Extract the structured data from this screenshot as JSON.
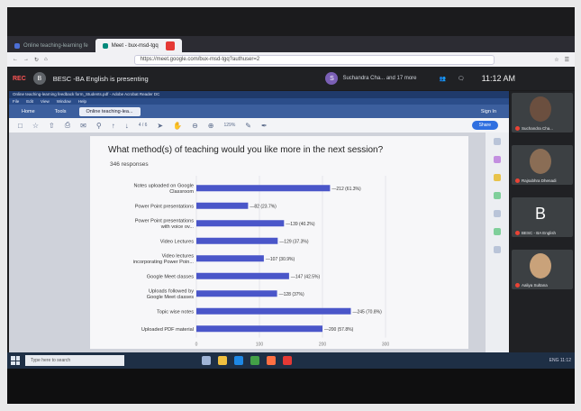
{
  "browser": {
    "tabs": [
      {
        "label": "Online teaching-learning fe",
        "active": false
      },
      {
        "label": "Meet - bux-msd-tgq",
        "active": true
      }
    ],
    "url": "https://meet.google.com/bux-msd-tgq?authuser=2"
  },
  "meet": {
    "rec_label": "REC",
    "presenter_initial": "B",
    "presenting_text": "BESC -BA English is presenting",
    "participants_text": "Suchandra Cha... and 17 more",
    "participants_initial": "S",
    "time": "11:12 AM"
  },
  "acrobat": {
    "title": "Online teaching-learning feedback form_Students.pdf - Adobe Acrobat Reader DC",
    "menu": [
      "File",
      "Edit",
      "View",
      "Window",
      "Help"
    ],
    "tabs": [
      "Home",
      "Tools",
      "Online teaching-lea..."
    ],
    "page_indicator": "4 / 6",
    "zoom": "129%",
    "sign_in": "Sign In",
    "share": "Share"
  },
  "question": {
    "title": "What method(s) of teaching would you like more in the next session?",
    "responses": "346 responses"
  },
  "chart_data": {
    "type": "bar",
    "orientation": "horizontal",
    "categories": [
      "Notes uploaded on Google Classroom",
      "Power Point presentations",
      "Power Point presentations with voice ov...",
      "Video Lectures",
      "Video lectures incorporating Power Poin...",
      "Google Meet classes",
      "Uploads followed by Google Meet classes",
      "Topic wise notes",
      "Uploaded PDF material"
    ],
    "category_lines": [
      [
        "Notes uploaded on Google",
        "Classroom"
      ],
      [
        "Power Point presentations"
      ],
      [
        "Power Point presentations",
        "with voice ov..."
      ],
      [
        "Video Lectures"
      ],
      [
        "Video lectures",
        "incorporating Power Poin..."
      ],
      [
        "Google Meet classes"
      ],
      [
        "Uploads followed by",
        "Google Meet classes"
      ],
      [
        "Topic wise notes"
      ],
      [
        "Uploaded PDF material"
      ]
    ],
    "values": [
      212,
      82,
      139,
      129,
      107,
      147,
      128,
      245,
      200
    ],
    "value_labels": [
      "212 (61.3%)",
      "82 (23.7%)",
      "139 (40.2%)",
      "129 (37.3%)",
      "107 (30.9%)",
      "147 (42.5%)",
      "128 (37%)",
      "245 (70.8%)",
      "200 (57.8%)"
    ],
    "xlim": [
      0,
      300
    ],
    "xticks": [
      "0",
      "100",
      "200",
      "300"
    ],
    "bar_color": "#4a56c9"
  },
  "participants": [
    {
      "name": "Suchandra Cha...",
      "kind": "video"
    },
    {
      "name": "Rajsubhra Dhenadi",
      "kind": "video"
    },
    {
      "name": "BESC - BA English",
      "kind": "letter",
      "letter": "B"
    },
    {
      "name": "Aaliya Sultana",
      "kind": "video"
    }
  ],
  "taskbar": {
    "search_placeholder": "Type here to search",
    "tray_text": "ENG 11:12"
  },
  "colors": {
    "meet_bg": "#202124",
    "acrobat_blue": "#2b4d8a",
    "accent_red": "#e53935"
  }
}
